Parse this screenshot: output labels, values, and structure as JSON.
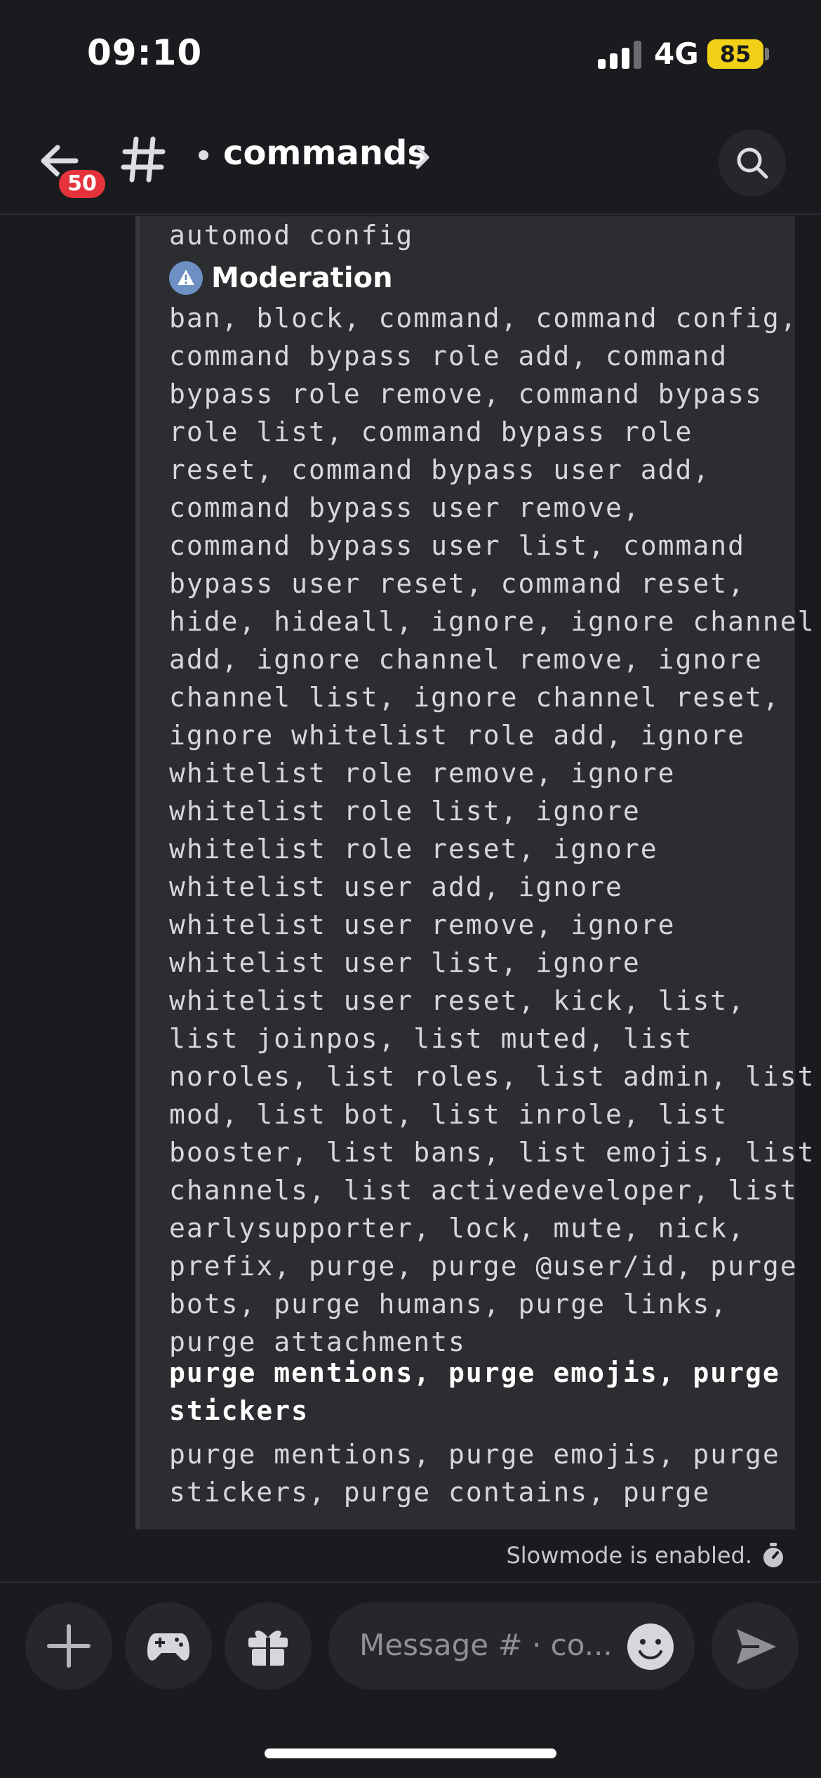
{
  "status_bar": {
    "time": "09:10",
    "network": "4G",
    "battery": "85",
    "battery_color": "#f2d018"
  },
  "header": {
    "unread_badge": "50",
    "channel_name": "commands",
    "icons": [
      "back-arrow-icon",
      "hash-icon",
      "chevron-right-icon",
      "search-icon"
    ]
  },
  "embed": {
    "top_text": "automod config",
    "field_title": "Moderation",
    "field_icon": "warning-icon",
    "field_lines": [
      "ban, block, command, command config,",
      "command bypass role add, command",
      "bypass role remove, command bypass",
      "role list, command bypass role",
      "reset, command bypass user add,",
      "command bypass user remove,",
      "command bypass user list, command",
      "bypass user reset, command reset,",
      "hide, hideall, ignore, ignore channel",
      "add, ignore channel remove, ignore",
      "channel list, ignore channel reset,",
      "ignore whitelist role add, ignore",
      "whitelist role remove, ignore",
      "whitelist role list, ignore",
      "whitelist role reset, ignore",
      "whitelist user add, ignore",
      "whitelist user remove, ignore",
      "whitelist user list, ignore",
      "whitelist user reset, kick, list,",
      "list joinpos, list muted, list",
      "noroles, list roles, list admin, list",
      "mod, list bot, list inrole, list",
      "booster, list bans, list emojis, list",
      "channels, list activedeveloper, list",
      "earlysupporter, lock, mute, nick,",
      "prefix, purge, purge @user/id, purge",
      "bots, purge humans, purge links,",
      "purge attachments"
    ],
    "bold_field_lines": [
      "purge mentions, purge emojis, purge",
      "stickers"
    ],
    "bold_body_lines": [
      "purge mentions, purge emojis, purge",
      "stickers, purge contains, purge"
    ]
  },
  "slowmode": {
    "text": "Slowmode is enabled."
  },
  "composer": {
    "placeholder": "Message # · co...",
    "buttons": [
      "plus-icon",
      "gamepad-icon",
      "gift-icon",
      "emoji-icon",
      "send-icon"
    ]
  }
}
